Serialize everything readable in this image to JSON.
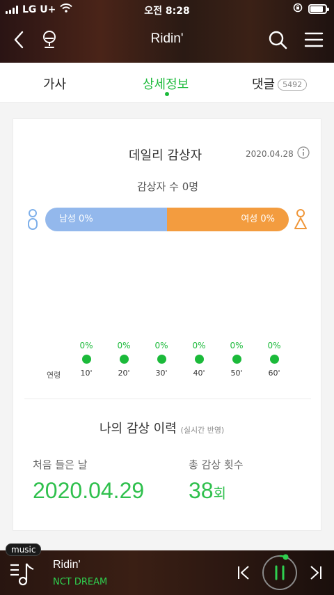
{
  "status": {
    "carrier": "LG U+",
    "time": "오전 8:28"
  },
  "header": {
    "title": "Ridin'"
  },
  "tabs": [
    {
      "label": "가사"
    },
    {
      "label": "상세정보"
    },
    {
      "label": "댓글",
      "count": "5492"
    }
  ],
  "daily": {
    "title": "데일리 감상자",
    "date": "2020.04.28",
    "viewers": "감상자 수 0명",
    "male": "남성 0%",
    "female": "여성 0%",
    "ages_label": "연령",
    "ages": [
      {
        "pct": "0%",
        "label": "10'"
      },
      {
        "pct": "0%",
        "label": "20'"
      },
      {
        "pct": "0%",
        "label": "30'"
      },
      {
        "pct": "0%",
        "label": "40'"
      },
      {
        "pct": "0%",
        "label": "50'"
      },
      {
        "pct": "0%",
        "label": "60'"
      }
    ]
  },
  "history": {
    "title": "나의 감상 이력",
    "subtitle": "(실시간 반영)",
    "first_label": "처음 들은 날",
    "first_value": "2020.04.29",
    "total_label": "총 감상 횟수",
    "total_value": "38",
    "total_unit": "회"
  },
  "player": {
    "tag": "music",
    "title": "Ridin'",
    "artist": "NCT DREAM"
  },
  "colors": {
    "accent": "#1bba3a",
    "male": "#93b8ec",
    "female": "#f39c3f"
  }
}
